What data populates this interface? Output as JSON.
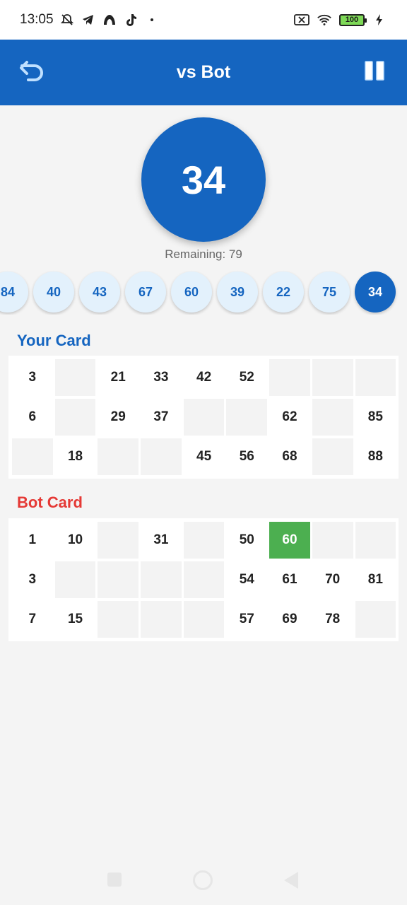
{
  "status_bar": {
    "time": "13:05",
    "battery": "100",
    "icons": [
      "muted-bell-icon",
      "telegram-icon",
      "app-icon",
      "tiktok-icon",
      "dot-icon",
      "no-sim-icon",
      "wifi-icon",
      "battery-icon",
      "charging-icon"
    ]
  },
  "app_bar": {
    "title": "vs Bot",
    "back_icon": "undo-arrow-icon",
    "pause_icon": "pause-icon",
    "color": "#1565c0"
  },
  "game": {
    "current_number": "34",
    "remaining": "Remaining: 79",
    "history": [
      "84",
      "40",
      "43",
      "67",
      "60",
      "39",
      "22",
      "75",
      "34"
    ]
  },
  "your_card": {
    "title": "Your Card",
    "rows": [
      [
        "3",
        "",
        "21",
        "33",
        "42",
        "52",
        "",
        "",
        ""
      ],
      [
        "6",
        "",
        "29",
        "37",
        "",
        "",
        "62",
        "",
        "85"
      ],
      [
        "",
        "18",
        "",
        "",
        "45",
        "56",
        "68",
        "",
        "88"
      ]
    ]
  },
  "bot_card": {
    "title": "Bot Card",
    "rows": [
      [
        "1",
        "10",
        "",
        "31",
        "",
        "50",
        "60",
        "",
        ""
      ],
      [
        "3",
        "",
        "",
        "",
        "",
        "54",
        "61",
        "70",
        "81"
      ],
      [
        "7",
        "15",
        "",
        "",
        "",
        "57",
        "69",
        "78",
        ""
      ]
    ],
    "marked": [
      "60"
    ]
  },
  "colors": {
    "primary": "#1565c0",
    "bot_title": "#e53935",
    "marked": "#4caf50"
  }
}
